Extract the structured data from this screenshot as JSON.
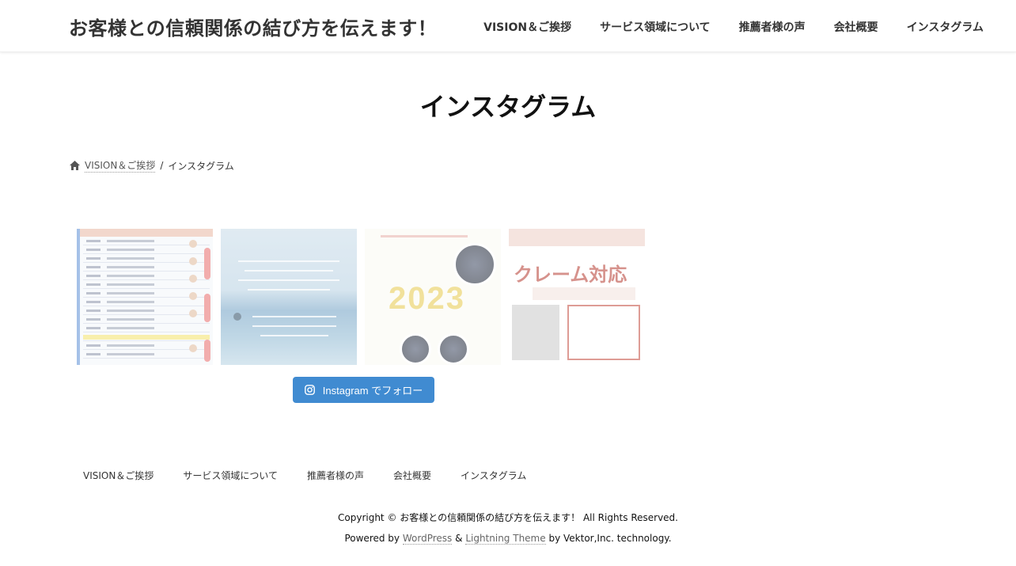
{
  "site": {
    "title": "お客様との信頼関係の結び方を伝えます！"
  },
  "nav": {
    "items": [
      {
        "label": "VISION＆ご挨拶"
      },
      {
        "label": "サービス領域について"
      },
      {
        "label": "推薦者様の声"
      },
      {
        "label": "会社概要"
      },
      {
        "label": "インスタグラム"
      }
    ]
  },
  "page": {
    "title": "インスタグラム"
  },
  "breadcrumb": {
    "home_icon": "home-icon",
    "home_label": "VISION＆ご挨拶",
    "separator": "/",
    "current": "インスタグラム"
  },
  "instagram": {
    "tiles": [
      {
        "subject": "schedule-table"
      },
      {
        "subject": "ocean-surfer"
      },
      {
        "subject": "2023-new-year",
        "text": "2023"
      },
      {
        "subject": "claim-handling",
        "text": "クレーム対応"
      }
    ],
    "follow_icon": "instagram-icon",
    "follow_label": "Instagram でフォロー",
    "follow_color": "#408bd1"
  },
  "footer": {
    "nav": [
      {
        "label": "VISION＆ご挨拶"
      },
      {
        "label": "サービス領域について"
      },
      {
        "label": "推薦者様の声"
      },
      {
        "label": "会社概要"
      },
      {
        "label": "インスタグラム"
      }
    ],
    "copyright": "Copyright © お客様との信頼関係の結び方を伝えます！ All Rights Reserved.",
    "powered_prefix": "Powered by",
    "wordpress": "WordPress",
    "amp": "&",
    "theme": "Lightning Theme",
    "powered_suffix": "by Vektor,Inc. technology."
  }
}
